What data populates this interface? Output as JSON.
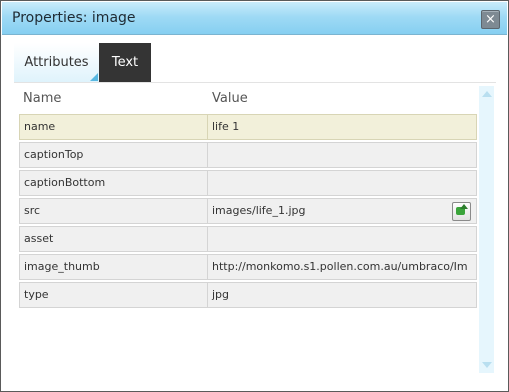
{
  "dialog": {
    "title": "Properties: image",
    "close_label": "×"
  },
  "tabs": [
    {
      "label": "Attributes",
      "active": false
    },
    {
      "label": "Text",
      "active": true
    }
  ],
  "table": {
    "headers": {
      "name": "Name",
      "value": "Value"
    },
    "rows": [
      {
        "name": "name",
        "value": "life 1",
        "selected": true
      },
      {
        "name": "captionTop",
        "value": ""
      },
      {
        "name": "captionBottom",
        "value": ""
      },
      {
        "name": "src",
        "value": "images/life_1.jpg",
        "has_browse_button": true
      },
      {
        "name": "asset",
        "value": ""
      },
      {
        "name": "image_thumb",
        "value": "http://monkomo.s1.pollen.com.au/umbraco/Im"
      },
      {
        "name": "type",
        "value": "jpg"
      }
    ]
  },
  "icons": {
    "close": "close-icon",
    "browse": "browse-file-icon",
    "scroll_up": "scroll-up-arrow-icon",
    "scroll_down": "scroll-down-arrow-icon"
  },
  "colors": {
    "titlebar": "#9fdaf5",
    "active_tab": "#343434",
    "selected_row": "#f2f0da",
    "scrollbar": "#e6f6fd"
  }
}
